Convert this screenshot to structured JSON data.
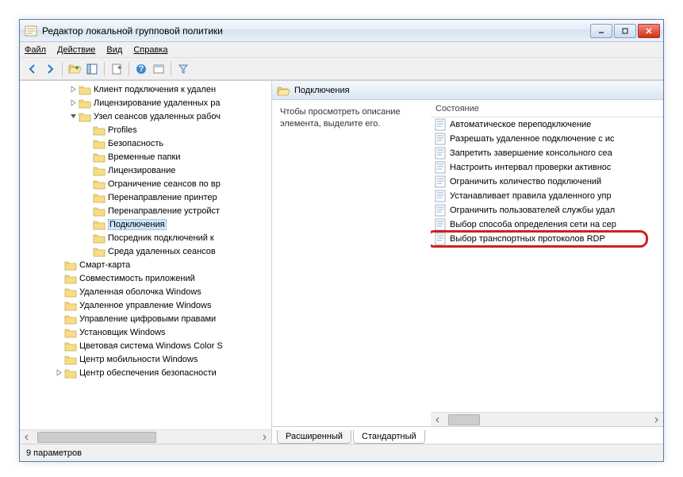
{
  "window": {
    "title": "Редактор локальной групповой политики"
  },
  "menu": {
    "file": "Файл",
    "action": "Действие",
    "view": "Вид",
    "help": "Справка"
  },
  "tree": {
    "items": [
      {
        "indent": 3,
        "expander": "right",
        "label": "Клиент подключения к удален"
      },
      {
        "indent": 3,
        "expander": "right",
        "label": "Лицензирование удаленных ра"
      },
      {
        "indent": 3,
        "expander": "down",
        "label": "Узел сеансов удаленных рабоч"
      },
      {
        "indent": 4,
        "expander": "none",
        "label": "Profiles"
      },
      {
        "indent": 4,
        "expander": "none",
        "label": "Безопасность"
      },
      {
        "indent": 4,
        "expander": "none",
        "label": "Временные папки"
      },
      {
        "indent": 4,
        "expander": "none",
        "label": "Лицензирование"
      },
      {
        "indent": 4,
        "expander": "none",
        "label": "Ограничение сеансов по вр"
      },
      {
        "indent": 4,
        "expander": "none",
        "label": "Перенаправление принтер"
      },
      {
        "indent": 4,
        "expander": "none",
        "label": "Перенаправление устройст"
      },
      {
        "indent": 4,
        "expander": "none",
        "label": "Подключения",
        "selected": true
      },
      {
        "indent": 4,
        "expander": "none",
        "label": "Посредник подключений к"
      },
      {
        "indent": 4,
        "expander": "none",
        "label": "Среда удаленных сеансов"
      },
      {
        "indent": 2,
        "expander": "none",
        "label": "Смарт-карта"
      },
      {
        "indent": 2,
        "expander": "none",
        "label": "Совместимость приложений"
      },
      {
        "indent": 2,
        "expander": "none",
        "label": "Удаленная оболочка Windows"
      },
      {
        "indent": 2,
        "expander": "none",
        "label": "Удаленное управление Windows"
      },
      {
        "indent": 2,
        "expander": "none",
        "label": "Управление цифровыми правами"
      },
      {
        "indent": 2,
        "expander": "none",
        "label": "Установщик Windows"
      },
      {
        "indent": 2,
        "expander": "none",
        "label": "Цветовая система Windows Color S"
      },
      {
        "indent": 2,
        "expander": "none",
        "label": "Центр мобильности Windows"
      },
      {
        "indent": 2,
        "expander": "right",
        "label": "Центр обеспечения безопасности"
      }
    ]
  },
  "right": {
    "title": "Подключения",
    "description": "Чтобы просмотреть описание элемента, выделите его.",
    "column_header": "Состояние",
    "items": [
      "Автоматическое переподключение",
      "Разрешать удаленное подключение с ис",
      "Запретить завершение консольного сеа",
      "Настроить интервал проверки активнос",
      "Ограничить количество подключений",
      "Устанавливает правила удаленного упр",
      "Ограничить пользователей службы удал",
      "Выбор способа определения сети на сер",
      "Выбор транспортных протоколов RDP"
    ],
    "highlighted_index": 8
  },
  "tabs": {
    "extended": "Расширенный",
    "standard": "Стандартный"
  },
  "status": {
    "text": "9 параметров"
  }
}
